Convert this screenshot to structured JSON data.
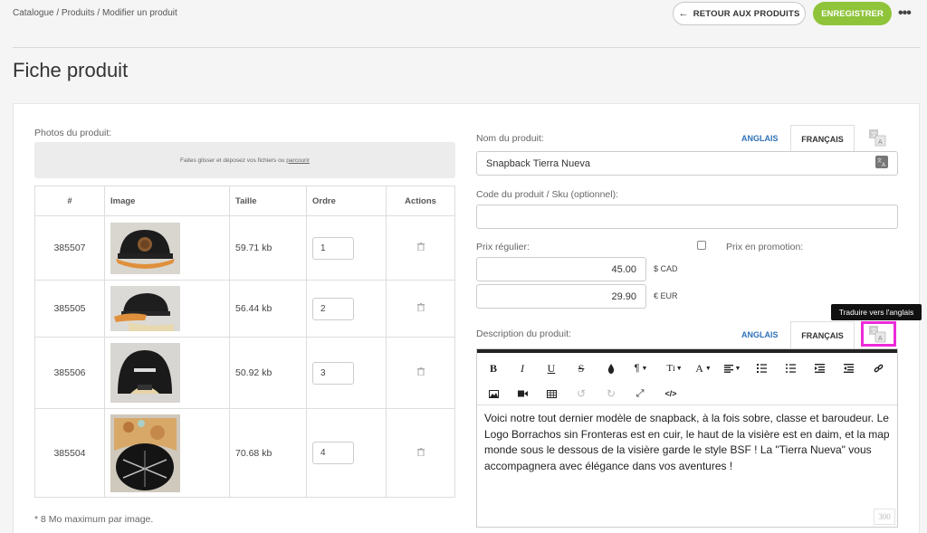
{
  "breadcrumb": "Catalogue / Produits / Modifier un produit",
  "header": {
    "back_label": "RETOUR AUX PRODUITS",
    "save_label": "ENREGISTRER",
    "more_label": "•••"
  },
  "page_title": "Fiche produit",
  "photos": {
    "label": "Photos du produit:",
    "dropzone_text": "Faites glisser et déposez vos fichiers ou",
    "dropzone_link": "parcourir",
    "columns": [
      "#",
      "Image",
      "Taille",
      "Ordre",
      "Actions"
    ],
    "rows": [
      {
        "id": "385507",
        "size": "59.71 kb",
        "order": "1",
        "image": "cap-front-patch"
      },
      {
        "id": "385505",
        "size": "56.44 kb",
        "order": "2",
        "image": "cap-side"
      },
      {
        "id": "385506",
        "size": "50.92 kb",
        "order": "3",
        "image": "cap-back"
      },
      {
        "id": "385504",
        "size": "70.68 kb",
        "order": "4",
        "image": "cap-underside-map"
      }
    ],
    "footnote": "* 8 Mo maximum par image."
  },
  "product": {
    "name_label": "Nom du produit:",
    "name_value": "Snapback Tierra Nueva",
    "sku_label": "Code du produit / Sku (optionnel):",
    "sku_value": "",
    "price_label": "Prix régulier:",
    "promo_label": "Prix en promotion:",
    "price_cad": "45.00",
    "currency_cad": "$ CAD",
    "price_eur": "29.90",
    "currency_eur": "€ EUR",
    "description_label": "Description du produit:",
    "description": "Voici notre tout dernier modèle de snapback, à la fois sobre, classe et baroudeur. Le Logo Borrachos sin Fronteras est en cuir, le haut de la visière est en daim, et la map monde sous le dessous de la visière garde le style BSF ! La \"Tierra Nueva\" vous accompagnera avec élégance dans vos aventures !",
    "char_count": "300"
  },
  "tabs": {
    "english": "ANGLAIS",
    "french": "FRANÇAIS"
  },
  "tooltip": "Traduire vers l'anglais",
  "toolbar": {
    "bold": "B",
    "italic": "I",
    "underline": "U",
    "strike": "S",
    "paragraph": "¶",
    "font_size": "T",
    "font_color": "A",
    "code_view": "</>"
  },
  "colors": {
    "accent_green": "#8fc43a",
    "link_blue": "#2f72b8",
    "highlight_magenta": "#ec2bd8"
  }
}
